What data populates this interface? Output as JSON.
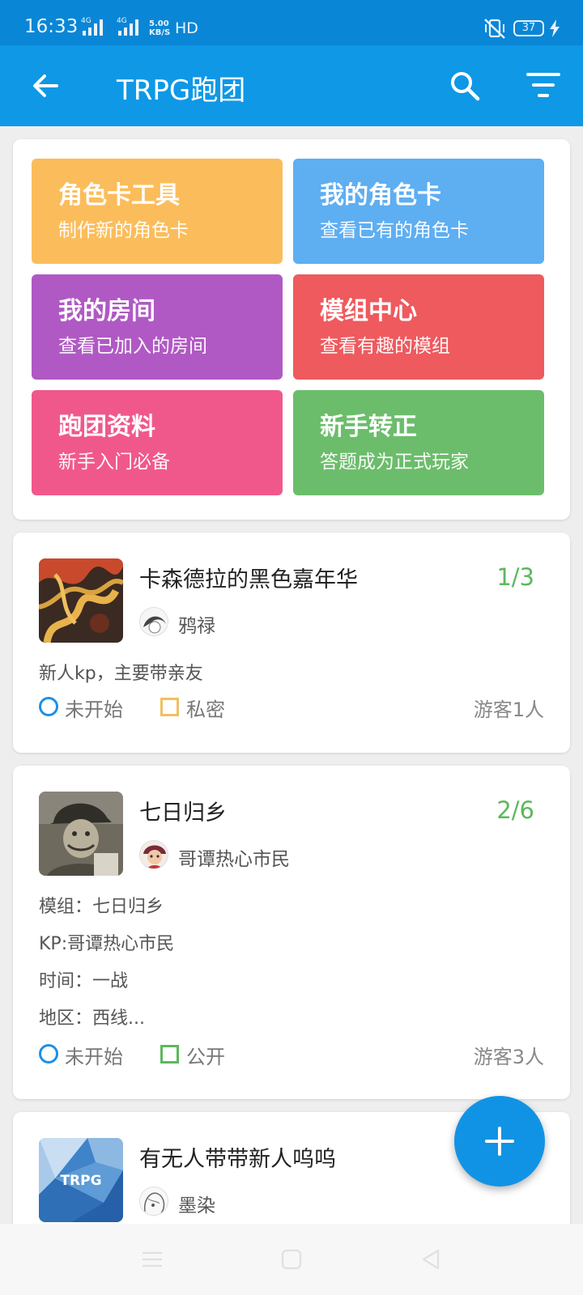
{
  "status_bar": {
    "time": "16:33",
    "sim1": "4G",
    "sim2": "4G",
    "net_speed_value": "5.00",
    "net_speed_unit": "KB/S",
    "hd": "HD",
    "battery": "37"
  },
  "app_bar": {
    "title": "TRPG跑团",
    "back_icon": "arrow-left-icon",
    "search_icon": "search-icon",
    "filter_icon": "filter-icon"
  },
  "tiles": [
    {
      "title": "角色卡工具",
      "subtitle": "制作新的角色卡",
      "color": "#fbbd5b"
    },
    {
      "title": "我的角色卡",
      "subtitle": "查看已有的角色卡",
      "color": "#5eaef2"
    },
    {
      "title": "我的房间",
      "subtitle": "查看已加入的房间",
      "color": "#b059c4"
    },
    {
      "title": "模组中心",
      "subtitle": "查看有趣的模组",
      "color": "#ee5a5e"
    },
    {
      "title": "跑团资料",
      "subtitle": "新手入门必备",
      "color": "#f0588c"
    },
    {
      "title": "新手转正",
      "subtitle": "答题成为正式玩家",
      "color": "#6bbd6b"
    }
  ],
  "rooms": [
    {
      "name": "卡森德拉的黑色嘉年华",
      "count": "1/3",
      "host": "鸦禄",
      "desc": [
        "新人kp，主要带亲友"
      ],
      "status": "未开始",
      "visibility": "私密",
      "visibility_color": "#f0c060",
      "guests": "游客1人"
    },
    {
      "name": "七日归乡",
      "count": "2/6",
      "host": "哥谭热心市民",
      "desc": [
        "模组：七日归乡",
        "KP:哥谭热心市民",
        "时间：一战",
        "地区：西线..."
      ],
      "status": "未开始",
      "visibility": "公开",
      "visibility_color": "#5cb85c",
      "guests": "游客3人"
    },
    {
      "name": "有无人带带新人呜呜",
      "host": "墨染",
      "cover_text": "TRPG"
    }
  ],
  "fab": {
    "icon": "plus-icon"
  },
  "nav_bar": {
    "icons": [
      "menu-icon",
      "home-square-icon",
      "back-triangle-icon"
    ]
  }
}
